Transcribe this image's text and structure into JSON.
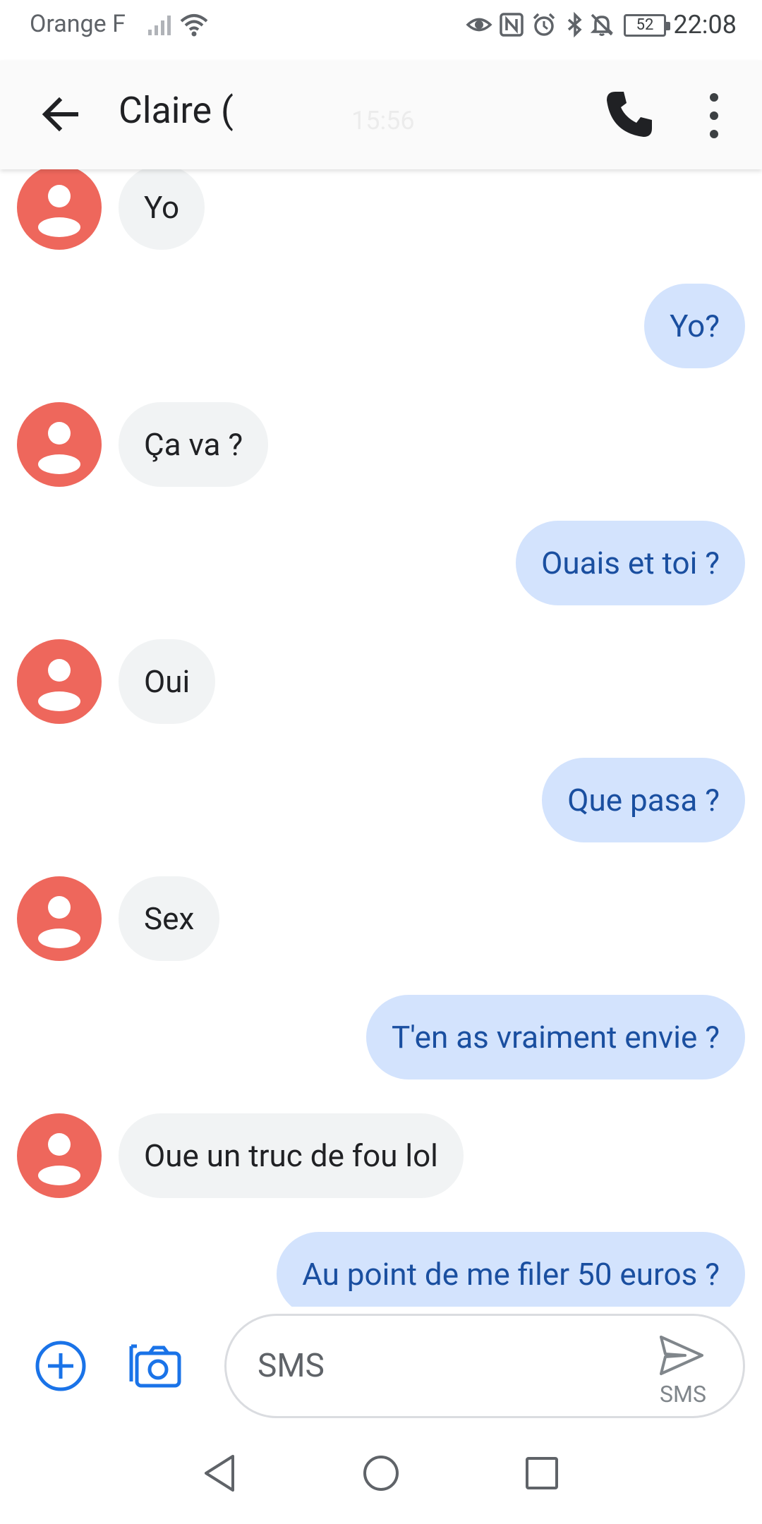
{
  "status_bar": {
    "carrier": "Orange F",
    "battery": "52",
    "time": "22:08"
  },
  "header": {
    "back_icon": "arrow-left-icon",
    "title": "Claire (",
    "ghost_time": "15:56",
    "call_icon": "phone-icon",
    "menu_icon": "more-vertical-icon"
  },
  "messages": [
    {
      "direction": "incoming",
      "text": "Yo"
    },
    {
      "direction": "outgoing",
      "text": "Yo?"
    },
    {
      "direction": "incoming",
      "text": "Ça va ?"
    },
    {
      "direction": "outgoing",
      "text": "Ouais et toi ?"
    },
    {
      "direction": "incoming",
      "text": "Oui"
    },
    {
      "direction": "outgoing",
      "text": "Que pasa ?"
    },
    {
      "direction": "incoming",
      "text": "Sex"
    },
    {
      "direction": "outgoing",
      "text": "T'en as vraiment envie ?"
    },
    {
      "direction": "incoming",
      "text": "Oue un truc de fou lol"
    },
    {
      "direction": "outgoing",
      "text": "Au point de me filer 50 euros ?"
    }
  ],
  "compose": {
    "placeholder": "SMS",
    "send_label": "SMS"
  },
  "colors": {
    "avatar": "#ee675c",
    "incoming_bubble": "#f1f3f4",
    "outgoing_bubble": "#d3e3fd",
    "outgoing_text": "#1a4fa0",
    "accent": "#1a73e8"
  }
}
